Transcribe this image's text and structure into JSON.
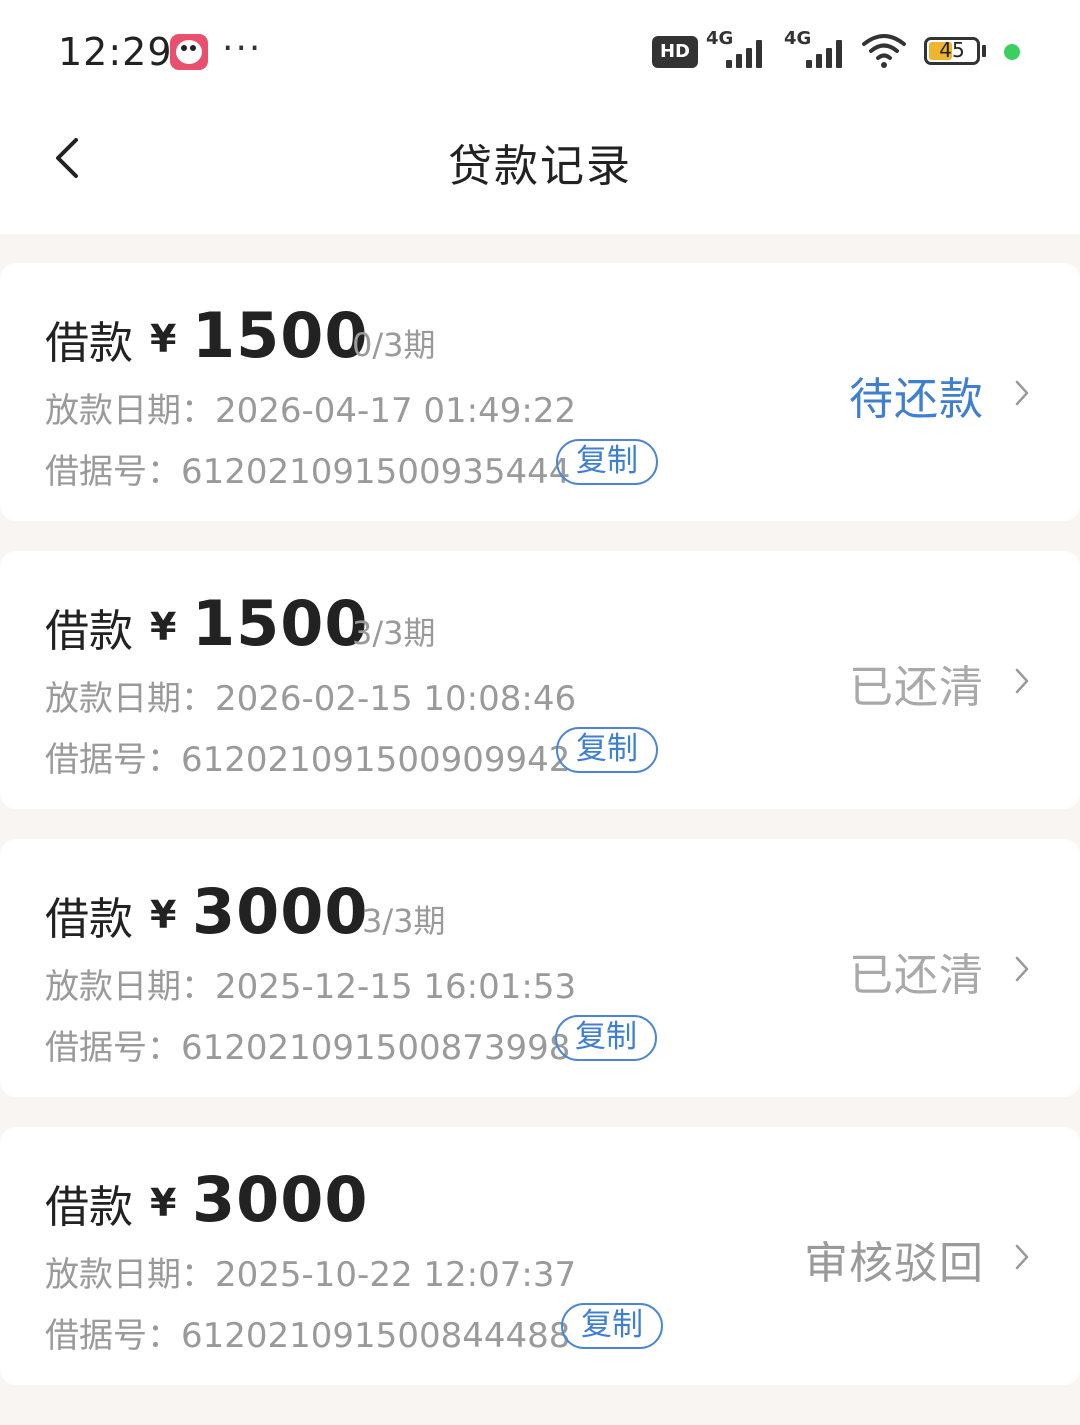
{
  "status_bar": {
    "time": "12:29",
    "more": "···",
    "hd_label": "HD",
    "net1": "4G",
    "net2": "4G",
    "battery": "45",
    "battery_color": "#f0b530"
  },
  "header": {
    "title": "贷款记录",
    "back_icon": "chevron-left-icon"
  },
  "colors": {
    "pending": "#3f7fd3",
    "done": "#a9a9a9",
    "rejected": "#9a9a9a",
    "copy": "#3f7fd3"
  },
  "loans": [
    {
      "label": "借款",
      "currency": "¥",
      "amount": "1500",
      "periods": "0/3期",
      "date_label": "放款日期：",
      "date": "2026-04-17 01:49:22",
      "no_label": "借据号：",
      "no": "612021091500935444",
      "copy": "复制",
      "status": "待还款"
    },
    {
      "label": "借款",
      "currency": "¥",
      "amount": "1500",
      "periods": "3/3期",
      "date_label": "放款日期：",
      "date": "2026-02-15 10:08:46",
      "no_label": "借据号：",
      "no": "612021091500909942",
      "copy": "复制",
      "status": "已还清"
    },
    {
      "label": "借款",
      "currency": "¥",
      "amount": "3000",
      "periods": "3/3期",
      "date_label": "放款日期：",
      "date": "2025-12-15 16:01:53",
      "no_label": "借据号：",
      "no": "612021091500873998",
      "copy": "复制",
      "status": "已还清"
    },
    {
      "label": "借款",
      "currency": "¥",
      "amount": "3000",
      "periods": "",
      "date_label": "放款日期：",
      "date": "2025-10-22 12:07:37",
      "no_label": "借据号：",
      "no": "612021091500844488",
      "copy": "复制",
      "status": "审核驳回"
    }
  ]
}
